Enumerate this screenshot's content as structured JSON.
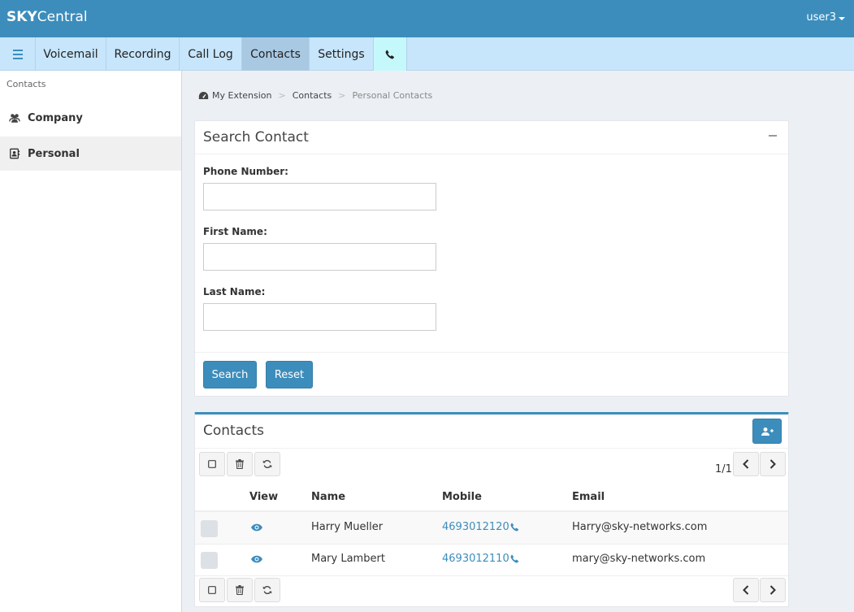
{
  "header": {
    "brand_bold": "SKY",
    "brand_rest": "Central",
    "user": "user3"
  },
  "nav": {
    "tabs": [
      {
        "label": "Voicemail"
      },
      {
        "label": "Recording"
      },
      {
        "label": "Call Log"
      },
      {
        "label": "Contacts",
        "active": true
      },
      {
        "label": "Settings"
      }
    ],
    "phone_icon": "phone-icon"
  },
  "sidebar": {
    "header": "Contacts",
    "items": [
      {
        "label": "Company",
        "icon": "users-icon"
      },
      {
        "label": "Personal",
        "icon": "address-card-icon",
        "active": true
      }
    ]
  },
  "breadcrumb": {
    "root": "My Extension",
    "mid": "Contacts",
    "current": "Personal Contacts"
  },
  "search": {
    "title": "Search Contact",
    "phone_label": "Phone Number:",
    "phone_value": "",
    "first_label": "First Name:",
    "first_value": "",
    "last_label": "Last Name:",
    "last_value": "",
    "search_btn": "Search",
    "reset_btn": "Reset"
  },
  "contacts": {
    "title": "Contacts",
    "pager": "1/1",
    "columns": {
      "view": "View",
      "name": "Name",
      "mobile": "Mobile",
      "email": "Email"
    },
    "rows": [
      {
        "name": "Harry Mueller",
        "mobile": "4693012120",
        "email": "Harry@sky-networks.com"
      },
      {
        "name": "Mary Lambert",
        "mobile": "4693012110",
        "email": "mary@sky-networks.com"
      }
    ]
  },
  "colors": {
    "primary": "#3c8dbc",
    "nav_bg": "#c7e5fb",
    "nav_active": "#a9c9e3",
    "phone_tab": "#c5f8fb"
  }
}
